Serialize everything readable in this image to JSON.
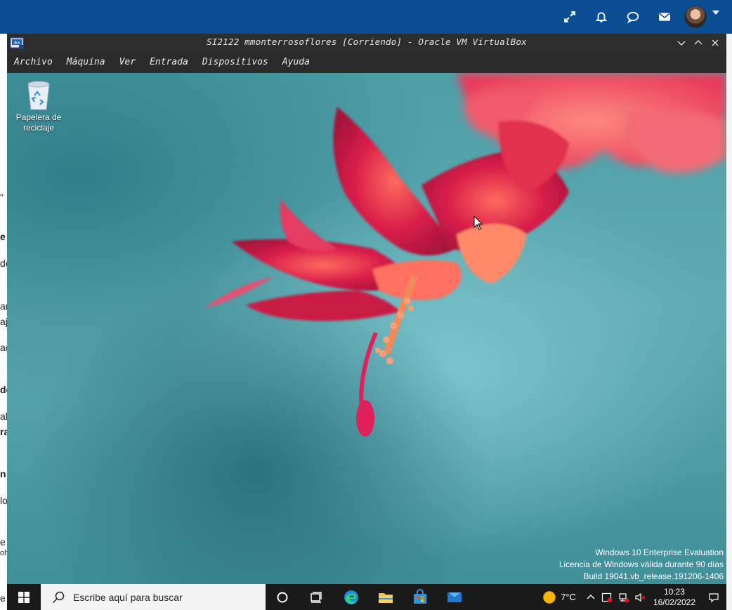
{
  "host": {
    "icons": [
      "expand-icon",
      "bell-icon",
      "chat-bubble-icon",
      "mail-icon"
    ],
    "left_strip_fragments": [
      "\"",
      "e",
      "de",
      "ar",
      "aj",
      "ac",
      "de",
      "al",
      "ra",
      "n",
      "lo",
      "e",
      "oh",
      "e"
    ]
  },
  "vbox": {
    "title": "SI2122 mmonterrosoflores [Corriendo] - Oracle VM VirtualBox",
    "menu": [
      "Archivo",
      "Máquina",
      "Ver",
      "Entrada",
      "Dispositivos",
      "Ayuda"
    ]
  },
  "desktop": {
    "recycle_bin_label": "Papelera de reciclaje",
    "watermark": {
      "line1": "Windows 10 Enterprise Evaluation",
      "line2": "Licencia de Windows válida durante 90 días",
      "line3": "Build 19041.vb_release.191206-1406"
    }
  },
  "taskbar": {
    "search_placeholder": "Escribe aquí para buscar",
    "apps": [
      "cortana-circle-icon",
      "task-view-icon",
      "edge-icon",
      "file-explorer-icon",
      "store-icon",
      "mail-icon"
    ],
    "weather": "7°C",
    "time": "10:23",
    "date": "16/02/2022"
  },
  "colors": {
    "host_topbar": "#0a4e91",
    "vbox_chrome": "#2b2b2b",
    "taskbar": "#1a1a1a",
    "desktop_teal": "#5eaab2",
    "flower_red": "#d81e4a"
  }
}
